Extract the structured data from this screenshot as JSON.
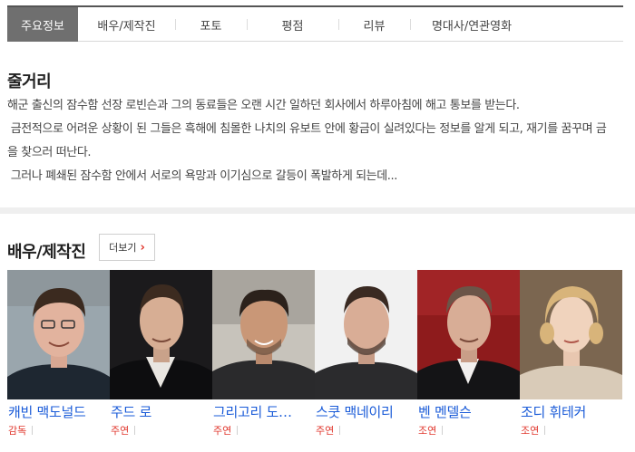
{
  "tabs": [
    {
      "label": "주요정보",
      "active": true
    },
    {
      "label": "배우/제작진",
      "active": false
    },
    {
      "label": "포토",
      "active": false
    },
    {
      "label": "평점",
      "active": false
    },
    {
      "label": "리뷰",
      "active": false
    },
    {
      "label": "명대사/연관영화",
      "active": false
    }
  ],
  "synopsis": {
    "title": "줄거리",
    "paragraphs": [
      "해군 출신의 잠수함 선장 로빈슨과 그의 동료들은 오랜 시간 일하던 회사에서 하루아침에 해고 통보를 받는다.",
      " 금전적으로 어려운 상황이 된 그들은 흑해에 침몰한 나치의 유보트 안에 황금이 실려있다는 정보를 알게 되고, 재기를 꿈꾸며 금을 찾으러 떠난다.",
      " 그러나 폐쇄된 잠수함 안에서 서로의 욕망과 이기심으로 갈등이 폭발하게 되는데..."
    ]
  },
  "cast": {
    "title": "배우/제작진",
    "more_label": "더보기",
    "more_arrow": "›",
    "members": [
      {
        "name": "캐빈 맥도널드",
        "role": "감독"
      },
      {
        "name": "주드 로",
        "role": "주연"
      },
      {
        "name": "그리고리 도…",
        "role": "주연"
      },
      {
        "name": "스쿳 맥네이리",
        "role": "주연"
      },
      {
        "name": "벤 멘델슨",
        "role": "조연"
      },
      {
        "name": "조디 휘테커",
        "role": "조연"
      }
    ]
  },
  "colors": {
    "active_tab": "#6f6f6f",
    "link_blue": "#1a5bd8",
    "role_red": "#e0352b"
  }
}
